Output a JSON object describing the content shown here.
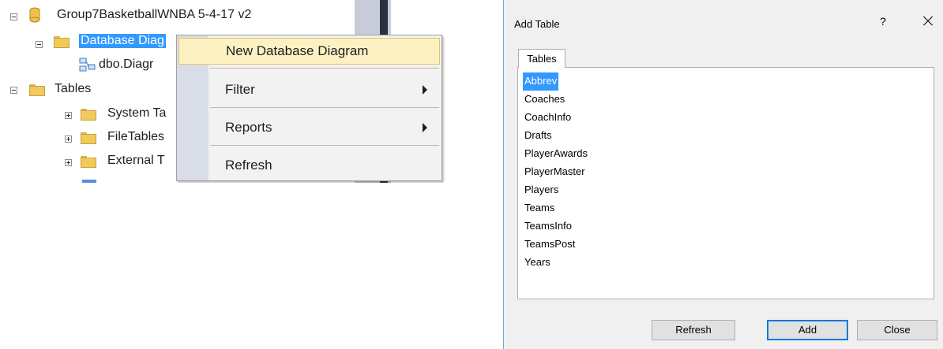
{
  "object_explorer": {
    "database_name": "Group7BasketballWNBA 5-4-17 v2",
    "nodes": {
      "database_diagrams": "Database Diag",
      "diagram_item": "dbo.Diagr",
      "tables": "Tables",
      "system_tables": "System Ta",
      "file_tables": "FileTables",
      "external_tables": "External T"
    }
  },
  "context_menu": {
    "items": [
      {
        "label": "New Database Diagram",
        "has_submenu": false
      },
      {
        "label": "Filter",
        "has_submenu": true
      },
      {
        "label": "Reports",
        "has_submenu": true
      },
      {
        "label": "Refresh",
        "has_submenu": false
      }
    ]
  },
  "dialog": {
    "title": "Add Table",
    "help_label": "?",
    "tab_label": "Tables",
    "tables": [
      "Abbrev",
      "Coaches",
      "CoachInfo",
      "Drafts",
      "PlayerAwards",
      "PlayerMaster",
      "Players",
      "Teams",
      "TeamsInfo",
      "TeamsPost",
      "Years"
    ],
    "selected_table": "Abbrev",
    "buttons": {
      "refresh": "Refresh",
      "add": "Add",
      "close": "Close"
    }
  },
  "colors": {
    "selection": "#3399ff",
    "menu_highlight": "#fcf1c2",
    "folder": "#f2ca5b",
    "default_button_border": "#0078d7"
  }
}
